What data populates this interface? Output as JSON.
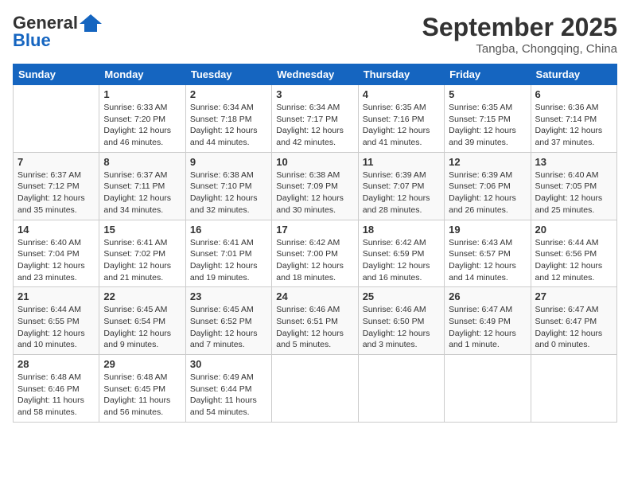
{
  "header": {
    "logo_general": "General",
    "logo_blue": "Blue",
    "month": "September 2025",
    "location": "Tangba, Chongqing, China"
  },
  "days_of_week": [
    "Sunday",
    "Monday",
    "Tuesday",
    "Wednesday",
    "Thursday",
    "Friday",
    "Saturday"
  ],
  "weeks": [
    [
      {
        "day": null
      },
      {
        "day": 1,
        "sunrise": "6:33 AM",
        "sunset": "7:20 PM",
        "daylight": "12 hours and 46 minutes."
      },
      {
        "day": 2,
        "sunrise": "6:34 AM",
        "sunset": "7:18 PM",
        "daylight": "12 hours and 44 minutes."
      },
      {
        "day": 3,
        "sunrise": "6:34 AM",
        "sunset": "7:17 PM",
        "daylight": "12 hours and 42 minutes."
      },
      {
        "day": 4,
        "sunrise": "6:35 AM",
        "sunset": "7:16 PM",
        "daylight": "12 hours and 41 minutes."
      },
      {
        "day": 5,
        "sunrise": "6:35 AM",
        "sunset": "7:15 PM",
        "daylight": "12 hours and 39 minutes."
      },
      {
        "day": 6,
        "sunrise": "6:36 AM",
        "sunset": "7:14 PM",
        "daylight": "12 hours and 37 minutes."
      }
    ],
    [
      {
        "day": 7,
        "sunrise": "6:37 AM",
        "sunset": "7:12 PM",
        "daylight": "12 hours and 35 minutes."
      },
      {
        "day": 8,
        "sunrise": "6:37 AM",
        "sunset": "7:11 PM",
        "daylight": "12 hours and 34 minutes."
      },
      {
        "day": 9,
        "sunrise": "6:38 AM",
        "sunset": "7:10 PM",
        "daylight": "12 hours and 32 minutes."
      },
      {
        "day": 10,
        "sunrise": "6:38 AM",
        "sunset": "7:09 PM",
        "daylight": "12 hours and 30 minutes."
      },
      {
        "day": 11,
        "sunrise": "6:39 AM",
        "sunset": "7:07 PM",
        "daylight": "12 hours and 28 minutes."
      },
      {
        "day": 12,
        "sunrise": "6:39 AM",
        "sunset": "7:06 PM",
        "daylight": "12 hours and 26 minutes."
      },
      {
        "day": 13,
        "sunrise": "6:40 AM",
        "sunset": "7:05 PM",
        "daylight": "12 hours and 25 minutes."
      }
    ],
    [
      {
        "day": 14,
        "sunrise": "6:40 AM",
        "sunset": "7:04 PM",
        "daylight": "12 hours and 23 minutes."
      },
      {
        "day": 15,
        "sunrise": "6:41 AM",
        "sunset": "7:02 PM",
        "daylight": "12 hours and 21 minutes."
      },
      {
        "day": 16,
        "sunrise": "6:41 AM",
        "sunset": "7:01 PM",
        "daylight": "12 hours and 19 minutes."
      },
      {
        "day": 17,
        "sunrise": "6:42 AM",
        "sunset": "7:00 PM",
        "daylight": "12 hours and 18 minutes."
      },
      {
        "day": 18,
        "sunrise": "6:42 AM",
        "sunset": "6:59 PM",
        "daylight": "12 hours and 16 minutes."
      },
      {
        "day": 19,
        "sunrise": "6:43 AM",
        "sunset": "6:57 PM",
        "daylight": "12 hours and 14 minutes."
      },
      {
        "day": 20,
        "sunrise": "6:44 AM",
        "sunset": "6:56 PM",
        "daylight": "12 hours and 12 minutes."
      }
    ],
    [
      {
        "day": 21,
        "sunrise": "6:44 AM",
        "sunset": "6:55 PM",
        "daylight": "12 hours and 10 minutes."
      },
      {
        "day": 22,
        "sunrise": "6:45 AM",
        "sunset": "6:54 PM",
        "daylight": "12 hours and 9 minutes."
      },
      {
        "day": 23,
        "sunrise": "6:45 AM",
        "sunset": "6:52 PM",
        "daylight": "12 hours and 7 minutes."
      },
      {
        "day": 24,
        "sunrise": "6:46 AM",
        "sunset": "6:51 PM",
        "daylight": "12 hours and 5 minutes."
      },
      {
        "day": 25,
        "sunrise": "6:46 AM",
        "sunset": "6:50 PM",
        "daylight": "12 hours and 3 minutes."
      },
      {
        "day": 26,
        "sunrise": "6:47 AM",
        "sunset": "6:49 PM",
        "daylight": "12 hours and 1 minute."
      },
      {
        "day": 27,
        "sunrise": "6:47 AM",
        "sunset": "6:47 PM",
        "daylight": "12 hours and 0 minutes."
      }
    ],
    [
      {
        "day": 28,
        "sunrise": "6:48 AM",
        "sunset": "6:46 PM",
        "daylight": "11 hours and 58 minutes."
      },
      {
        "day": 29,
        "sunrise": "6:48 AM",
        "sunset": "6:45 PM",
        "daylight": "11 hours and 56 minutes."
      },
      {
        "day": 30,
        "sunrise": "6:49 AM",
        "sunset": "6:44 PM",
        "daylight": "11 hours and 54 minutes."
      },
      {
        "day": null
      },
      {
        "day": null
      },
      {
        "day": null
      },
      {
        "day": null
      }
    ]
  ]
}
